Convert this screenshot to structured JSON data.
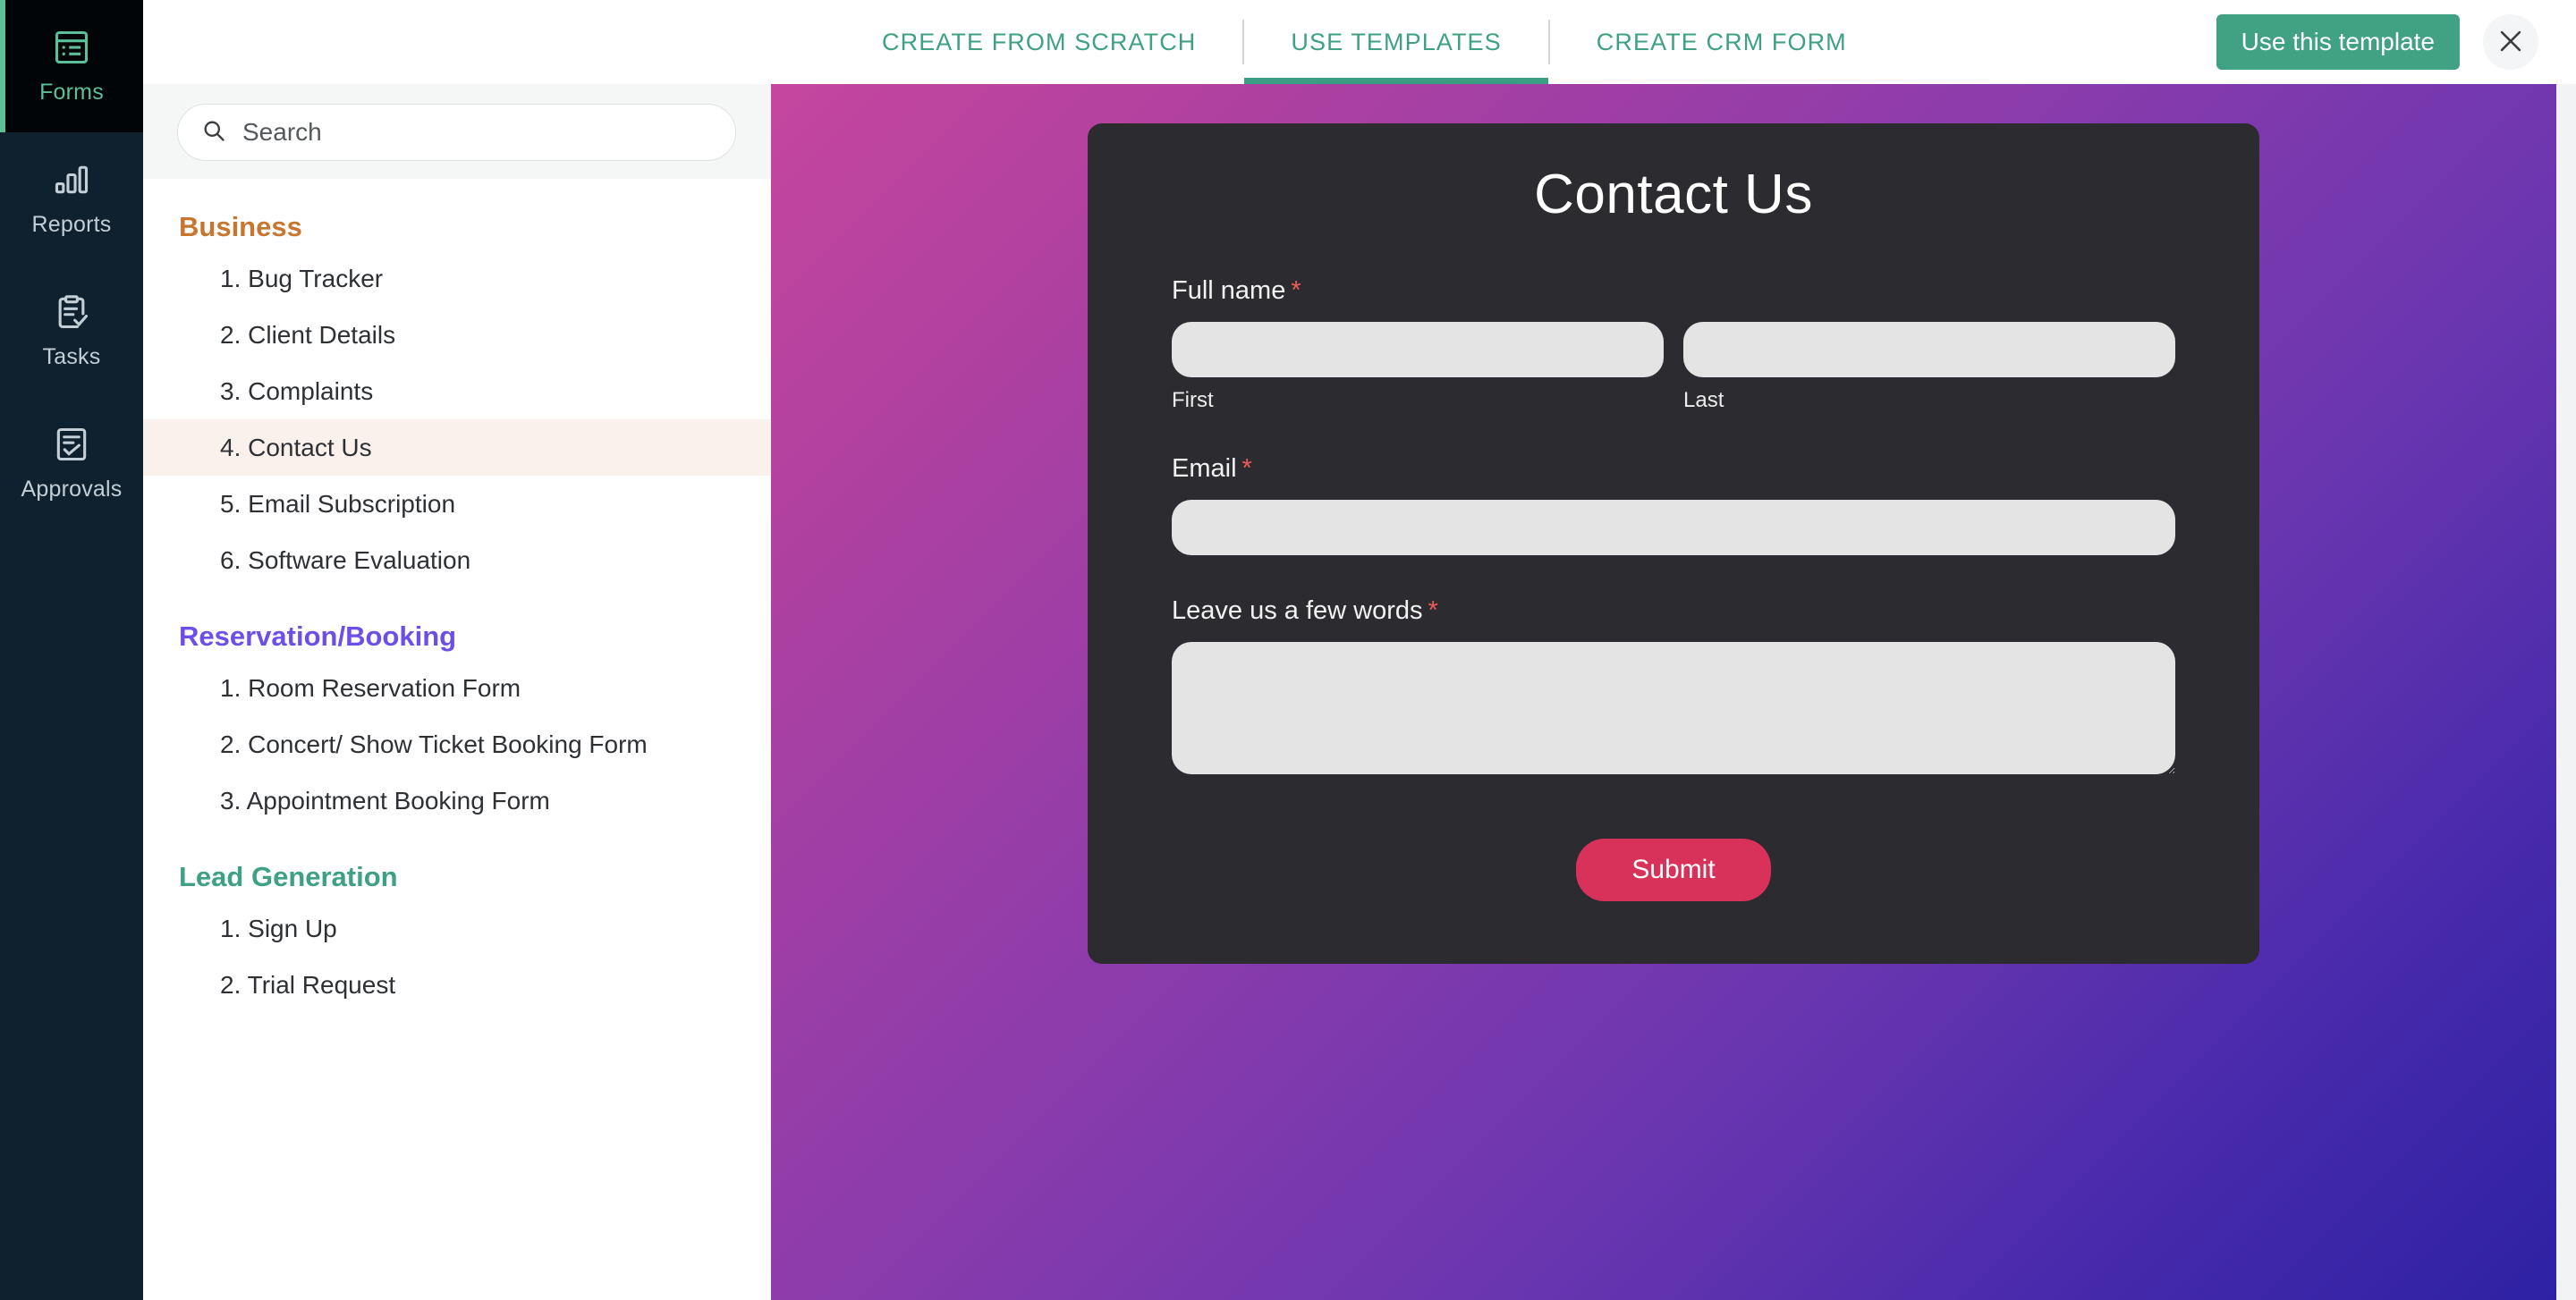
{
  "rail": {
    "items": [
      {
        "label": "Forms",
        "icon": "forms-icon",
        "active": true
      },
      {
        "label": "Reports",
        "icon": "reports-icon",
        "active": false
      },
      {
        "label": "Tasks",
        "icon": "tasks-icon",
        "active": false
      },
      {
        "label": "Approvals",
        "icon": "approvals-icon",
        "active": false
      }
    ]
  },
  "topbar": {
    "tabs": [
      {
        "label": "CREATE FROM SCRATCH",
        "active": false
      },
      {
        "label": "USE TEMPLATES",
        "active": true
      },
      {
        "label": "CREATE CRM FORM",
        "active": false
      }
    ],
    "use_template_label": "Use this template",
    "close_icon": "close-icon",
    "accent_color": "#3EA183"
  },
  "search": {
    "placeholder": "Search",
    "value": "",
    "icon": "search-icon"
  },
  "template_groups": [
    {
      "title": "Business",
      "color": "#C8762F",
      "class": "business",
      "items": [
        {
          "number": "1.",
          "label": "Bug Tracker",
          "selected": false
        },
        {
          "number": "2.",
          "label": "Client Details",
          "selected": false
        },
        {
          "number": "3.",
          "label": "Complaints",
          "selected": false
        },
        {
          "number": "4.",
          "label": "Contact Us",
          "selected": true
        },
        {
          "number": "5.",
          "label": "Email Subscription",
          "selected": false
        },
        {
          "number": "6.",
          "label": "Software Evaluation",
          "selected": false
        }
      ]
    },
    {
      "title": "Reservation/Booking",
      "color": "#6C4FE8",
      "class": "reservation",
      "items": [
        {
          "number": "1.",
          "label": "Room Reservation Form",
          "selected": false
        },
        {
          "number": "2.",
          "label": "Concert/ Show Ticket Booking Form",
          "selected": false
        },
        {
          "number": "3.",
          "label": "Appointment Booking Form",
          "selected": false
        }
      ]
    },
    {
      "title": "Lead Generation",
      "color": "#3EA183",
      "class": "lead",
      "items": [
        {
          "number": "1.",
          "label": "Sign Up",
          "selected": false
        },
        {
          "number": "2.",
          "label": "Trial Request",
          "selected": false
        }
      ]
    }
  ],
  "preview": {
    "gradient_from": "#C5469F",
    "gradient_to": "#2D21A3",
    "card_bg": "#2B2B30",
    "form": {
      "title": "Contact Us",
      "fields": {
        "full_name": {
          "label": "Full name",
          "required_mark": "*",
          "first": {
            "sublabel": "First",
            "value": "",
            "placeholder": ""
          },
          "last": {
            "sublabel": "Last",
            "value": "",
            "placeholder": ""
          }
        },
        "email": {
          "label": "Email",
          "required_mark": "*",
          "value": "",
          "placeholder": ""
        },
        "message": {
          "label": "Leave us a few words",
          "required_mark": "*",
          "value": "",
          "placeholder": ""
        }
      },
      "submit_label": "Submit",
      "submit_color": "#D8325A"
    }
  }
}
